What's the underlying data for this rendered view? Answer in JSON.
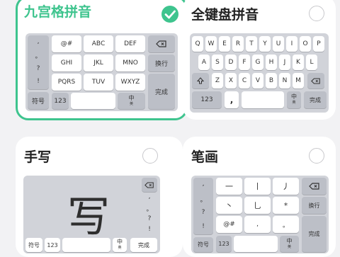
{
  "cards": {
    "jiugong": {
      "title": "九宫格拼音",
      "selected": true,
      "keys": {
        "punct": [
          ",",
          "。",
          "?",
          "!"
        ],
        "row1": [
          "@#",
          "ABC",
          "DEF"
        ],
        "row2": [
          "GHI",
          "JKL",
          "MNO"
        ],
        "row3": [
          "PQRS",
          "TUV",
          "WXYZ"
        ],
        "fuhao": "符号",
        "num": "123",
        "lang": "中",
        "lang_sub": "英",
        "huanhang": "换行",
        "done": "完成"
      }
    },
    "quanjian": {
      "title": "全键盘拼音",
      "selected": false,
      "keys": {
        "row1": [
          "Q",
          "W",
          "E",
          "R",
          "T",
          "Y",
          "U",
          "I",
          "O",
          "P"
        ],
        "row2": [
          "A",
          "S",
          "D",
          "F",
          "G",
          "H",
          "J",
          "K",
          "L"
        ],
        "row3": [
          "Z",
          "X",
          "C",
          "V",
          "B",
          "N",
          "M"
        ],
        "num": "123",
        "comma": ",",
        "small_punct": "。\n?",
        "lang": "中",
        "lang_sub": "英",
        "done": "完成"
      }
    },
    "shouxie": {
      "title": "手写",
      "selected": false,
      "glyph": "写",
      "keys": {
        "punct": [
          ",",
          "。",
          "?",
          "!"
        ],
        "fuhao": "符号",
        "num": "123",
        "lang": "中",
        "lang_sub": "英",
        "done": "完成"
      }
    },
    "bihua": {
      "title": "笔画",
      "selected": false,
      "keys": {
        "punct": [
          ",",
          "。",
          "?",
          "!"
        ],
        "row1": [
          "一",
          "丨",
          "丿"
        ],
        "row2": [
          "丶",
          "乚",
          "*"
        ],
        "row3": [
          "@#",
          ",",
          "。"
        ],
        "fuhao": "符号",
        "num": "123",
        "lang": "中",
        "lang_sub": "英",
        "huanhang": "换行",
        "done": "完成"
      }
    }
  },
  "colors": {
    "accent": "#3ec48e",
    "key_bg": "#ffffff",
    "keyboard_bg": "#d1d3d9",
    "dark_key": "#bcbfc7"
  },
  "icons": [
    "checkmark-icon",
    "backspace-icon",
    "shift-icon"
  ]
}
